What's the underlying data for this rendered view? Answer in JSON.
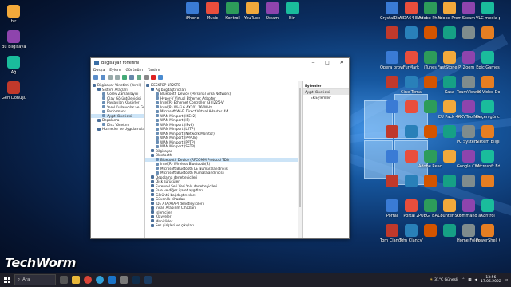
{
  "desktop": {
    "left_icons": [
      "bir",
      "Bu bilgisayar",
      "Ağ",
      "Geri Dönüşü..."
    ],
    "top_icons": [
      "iPhone",
      "Music",
      "Kontrol",
      "YouTube",
      "Steam",
      "Bin"
    ],
    "right_icons": [
      "CrystalDisk 8",
      "AIDA64 Extreme",
      "Adobe Photosh...",
      "Adobe Premiere P...",
      "Steam",
      "VLC media player",
      "",
      "",
      "",
      "",
      "",
      "",
      "Opera browser",
      "FurMark",
      "iTunes",
      "FastStone Photo Resizer",
      "Zoom",
      "Epic Games",
      "",
      "Cine Tema",
      "",
      "Kasa",
      "TeamViewer",
      "4K Video Downloader",
      "",
      "",
      "",
      "EU Pack 4K",
      "MKVToolNix",
      "Geçen güncelle...",
      "",
      "",
      "",
      "",
      "PC System Properties",
      "Sistem Bilgileri",
      "",
      "",
      "Adobe Reader",
      "",
      "Google Chrome",
      "Microsoft Edge",
      "",
      "",
      "",
      "",
      "",
      "",
      "Portal",
      "Portal 2",
      "PUBG: BATTLEGR...",
      "Counter-Strike: Global Offensive",
      "Command and Conquer...",
      "Kontrol",
      "Tom Clancy's Rainbow Six Siege",
      "Tom Clancy's Ghost Recon...",
      "",
      "",
      "Home Folder",
      "PowerShell Connect"
    ]
  },
  "window": {
    "title": "Bilgisayar Yönetimi",
    "menu": [
      "Dosya",
      "Eylem",
      "Görünüm",
      "Yardım"
    ],
    "left_tree": [
      {
        "label": "Bilgisayar Yönetimi (Yerel)",
        "indent": 0
      },
      {
        "label": "Sistem Araçları",
        "indent": 1
      },
      {
        "label": "Görev Zamanlayıcı",
        "indent": 2
      },
      {
        "label": "Olay Görüntüleyicisi",
        "indent": 2
      },
      {
        "label": "Paylaşılan Klasörler",
        "indent": 2
      },
      {
        "label": "Yerel Kullanıcılar ve Gru",
        "indent": 2
      },
      {
        "label": "Performans",
        "indent": 2
      },
      {
        "label": "Aygıt Yöneticisi",
        "indent": 2,
        "selected": true
      },
      {
        "label": "Depolama",
        "indent": 1
      },
      {
        "label": "Disk Yönetimi",
        "indent": 2
      },
      {
        "label": "Hizmetler ve Uygulamalar",
        "indent": 1
      }
    ],
    "device_tree": [
      {
        "label": "DESKTOP-1R2STE",
        "indent": 0
      },
      {
        "label": "Ağ bağdaştırıcıları",
        "indent": 1
      },
      {
        "label": "Bluetooth Device (Personal Area Network)",
        "indent": 2
      },
      {
        "label": "Hyper-V Virtual Ethernet Adapter",
        "indent": 2
      },
      {
        "label": "Intel(R) Ethernet Controller (3) I225-V",
        "indent": 2
      },
      {
        "label": "Intel(R) Wi-Fi 6 AX201 160MHz",
        "indent": 2
      },
      {
        "label": "Microsoft Wi-Fi Direct Virtual Adapter #4",
        "indent": 2
      },
      {
        "label": "WAN Miniport (IKEv2)",
        "indent": 2
      },
      {
        "label": "WAN Miniport (IP)",
        "indent": 2
      },
      {
        "label": "WAN Miniport (IPv6)",
        "indent": 2
      },
      {
        "label": "WAN Miniport (L2TP)",
        "indent": 2
      },
      {
        "label": "WAN Miniport (Network Monitor)",
        "indent": 2
      },
      {
        "label": "WAN Miniport (PPPOE)",
        "indent": 2
      },
      {
        "label": "WAN Miniport (PPTP)",
        "indent": 2
      },
      {
        "label": "WAN Miniport (SSTP)",
        "indent": 2
      },
      {
        "label": "Bilgisayar",
        "indent": 1
      },
      {
        "label": "Bluetooth",
        "indent": 1
      },
      {
        "label": "Bluetooth Device (RFCOMM Protocol TDI)",
        "indent": 2,
        "selected": true
      },
      {
        "label": "Intel(R) Wireless Bluetooth(R)",
        "indent": 2
      },
      {
        "label": "Microsoft Bluetooth LE Numaralandırıcısı",
        "indent": 2
      },
      {
        "label": "Microsoft Bluetooth Numaralandırıcısı",
        "indent": 2
      },
      {
        "label": "Depolama denetleyicileri",
        "indent": 1
      },
      {
        "label": "Disk sürücüleri",
        "indent": 1
      },
      {
        "label": "Evrensel Seri Veri Yolu denetleyicileri",
        "indent": 1
      },
      {
        "label": "Fare ve diğer işaret aygıtları",
        "indent": 1
      },
      {
        "label": "Görüntü bağdaştırıcıları",
        "indent": 1
      },
      {
        "label": "Güvenlik cihazları",
        "indent": 1
      },
      {
        "label": "IDE ATA/ATAPI denetleyicileri",
        "indent": 1
      },
      {
        "label": "İnsan Arabirim Cihazları",
        "indent": 1
      },
      {
        "label": "İşlemciler",
        "indent": 1
      },
      {
        "label": "Klavyeler",
        "indent": 1
      },
      {
        "label": "Monitörler",
        "indent": 1
      },
      {
        "label": "Ses girişleri ve çıkışları",
        "indent": 1
      }
    ],
    "actions": {
      "header": "Eylemler",
      "subheader": "Aygıt Yöneticisi",
      "item": "Ek Eylemler"
    }
  },
  "watermark": "TechWorm",
  "taskbar": {
    "search_label": "Ara",
    "weather": "31°C Güneşli",
    "time": "13:56",
    "date": "17.06.2022"
  }
}
